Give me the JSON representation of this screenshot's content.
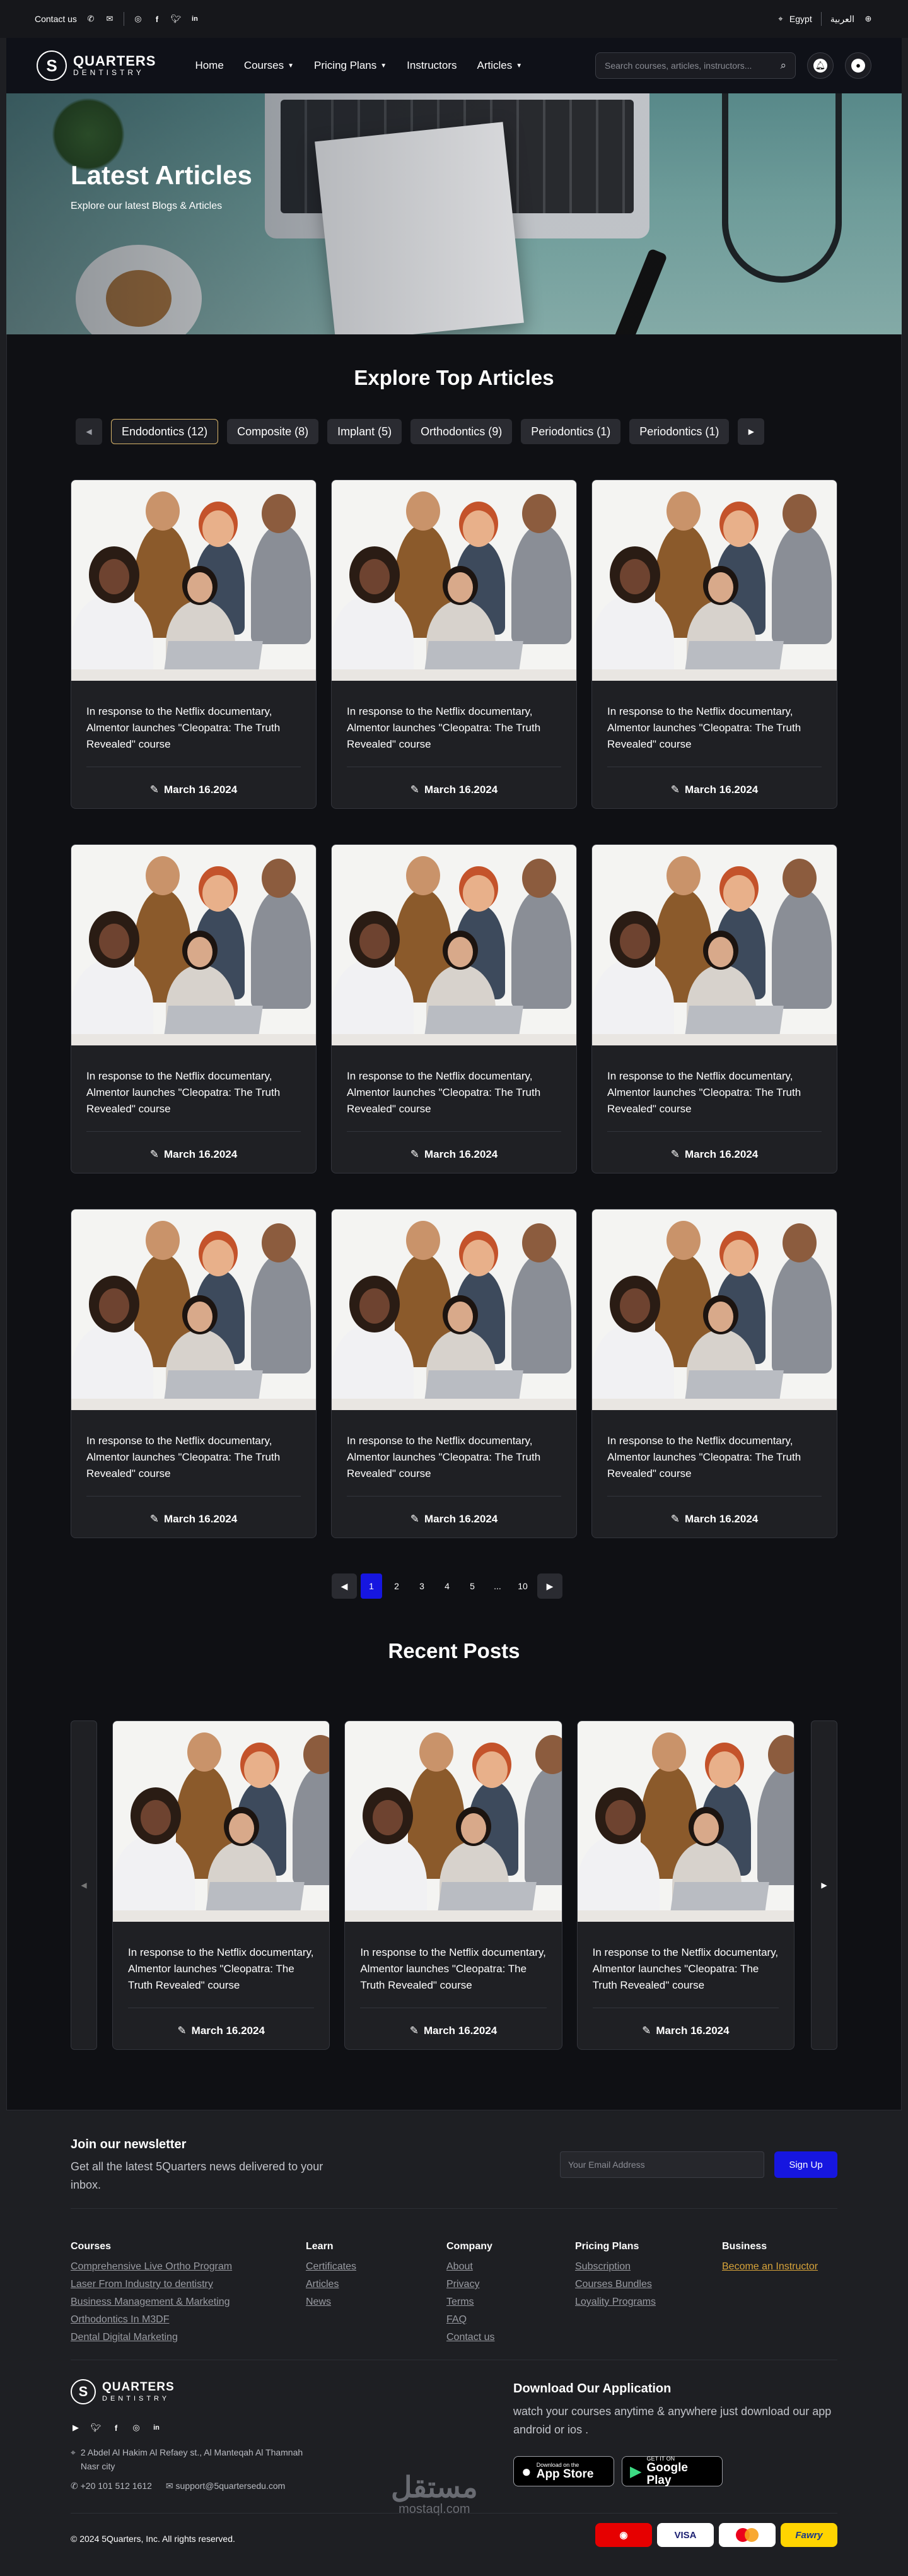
{
  "topbar": {
    "contact_label": "Contact us",
    "country": "Egypt",
    "language": "العربية"
  },
  "brand": {
    "line1": "QUARTERS",
    "line2": "DENTISTRY",
    "mark": "S"
  },
  "nav": {
    "items": [
      {
        "label": "Home",
        "dropdown": false
      },
      {
        "label": "Courses",
        "dropdown": true
      },
      {
        "label": "Pricing Plans",
        "dropdown": true
      },
      {
        "label": "Instructors",
        "dropdown": false
      },
      {
        "label": "Articles",
        "dropdown": true
      }
    ],
    "search_placeholder": "Search courses, articles, instructors..."
  },
  "hero": {
    "title": "Latest Articles",
    "subtitle": "Explore our latest Blogs & Articles"
  },
  "explore": {
    "title": "Explore Top Articles",
    "tabs": [
      "Endodontics (12)",
      "Composite (8)",
      "Implant (5)",
      "Orthodontics (9)",
      "Periodontics (1)",
      "Periodontics (1)"
    ],
    "active_tab": 0
  },
  "articles": [
    {
      "title": "In response to the Netflix documentary, Almentor launches \"Cleopatra: The Truth Revealed\" course",
      "date": "March 16.2024"
    },
    {
      "title": "In response to the Netflix documentary, Almentor launches \"Cleopatra: The Truth Revealed\" course",
      "date": "March 16.2024"
    },
    {
      "title": "In response to the Netflix documentary, Almentor launches \"Cleopatra: The Truth Revealed\" course",
      "date": "March 16.2024"
    },
    {
      "title": "In response to the Netflix documentary, Almentor launches \"Cleopatra: The Truth Revealed\" course",
      "date": "March 16.2024"
    },
    {
      "title": "In response to the Netflix documentary, Almentor launches \"Cleopatra: The Truth Revealed\" course",
      "date": "March 16.2024"
    },
    {
      "title": "In response to the Netflix documentary, Almentor launches \"Cleopatra: The Truth Revealed\" course",
      "date": "March 16.2024"
    },
    {
      "title": "In response to the Netflix documentary, Almentor launches \"Cleopatra: The Truth Revealed\" course",
      "date": "March 16.2024"
    },
    {
      "title": "In response to the Netflix documentary, Almentor launches \"Cleopatra: The Truth Revealed\" course",
      "date": "March 16.2024"
    },
    {
      "title": "In response to the Netflix documentary, Almentor launches \"Cleopatra: The Truth Revealed\" course",
      "date": "March 16.2024"
    }
  ],
  "pagination": {
    "pages": [
      "1",
      "2",
      "3",
      "4",
      "5",
      "...",
      "10"
    ],
    "current": "1"
  },
  "recent": {
    "title": "Recent Posts",
    "posts": [
      {
        "title": "In response to the Netflix documentary, Almentor launches \"Cleopatra: The Truth Revealed\" course",
        "date": "March 16.2024"
      },
      {
        "title": "In response to the Netflix documentary, Almentor launches \"Cleopatra: The Truth Revealed\" course",
        "date": "March 16.2024"
      },
      {
        "title": "In response to the Netflix documentary, Almentor launches \"Cleopatra: The Truth Revealed\" course",
        "date": "March 16.2024"
      }
    ]
  },
  "newsletter": {
    "title": "Join our newsletter",
    "text": "Get all the latest 5Quarters news delivered to your inbox.",
    "placeholder": "Your Email Address",
    "button": "Sign Up"
  },
  "footer_columns": [
    {
      "title": "Courses",
      "links": [
        "Comprehensive Live Ortho Program",
        "Laser From Industry to dentistry",
        "Business Management & Marketing",
        "Orthodontics In M3DF",
        "Dental Digital Marketing"
      ]
    },
    {
      "title": "Learn",
      "links": [
        "Certificates",
        "Articles",
        "News"
      ]
    },
    {
      "title": "Company",
      "links": [
        "About",
        "Privacy",
        "Terms",
        "FAQ",
        "Contact us"
      ]
    },
    {
      "title": "Pricing Plans",
      "links": [
        "Subscription",
        "Courses Bundles",
        "Loyality Programs"
      ]
    },
    {
      "title": "Business",
      "links": [
        "Become an Instructor"
      ]
    }
  ],
  "footer": {
    "address": "2 Abdel Al Hakim Al Refaey st., Al Manteqah Al Thamnah Nasr city",
    "phone": "+20 101 512 1612",
    "email": "support@5quartersedu.com",
    "app_title": "Download  Our Application",
    "app_text": "watch your courses anytime & anywhere just download our app android or ios .",
    "appstore_small": "Download on the",
    "appstore_big": "App Store",
    "googleplay_small": "GET IT ON",
    "googleplay_big": "Google Play",
    "copyright": "© 2024 5Quarters, Inc. All rights reserved.",
    "payments": [
      "Vodafone",
      "VISA",
      "Mastercard",
      "Fawry"
    ],
    "watermark_ar": "مستقل",
    "watermark_en": "mostaql.com"
  },
  "colors": {
    "accent_blue": "#1616e0",
    "gold": "#d9b56b",
    "bg": "#0f1014"
  }
}
